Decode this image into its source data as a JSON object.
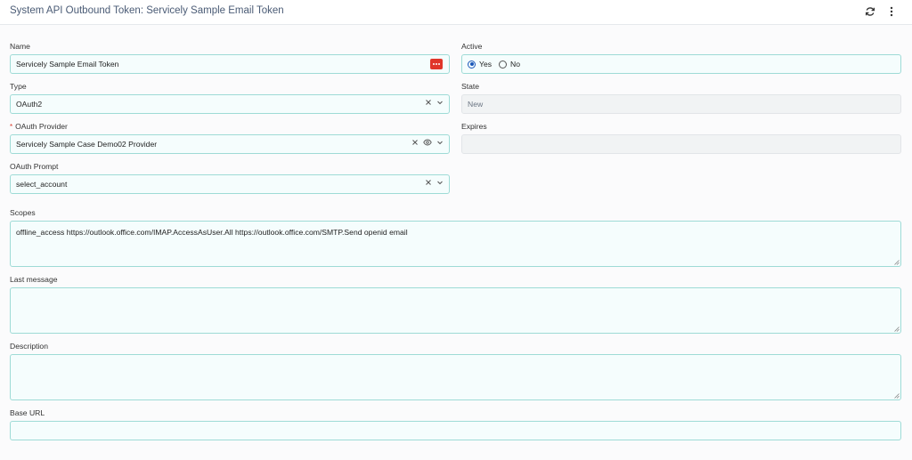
{
  "header": {
    "title": "System API Outbound Token: Servicely Sample Email Token",
    "refresh_icon": "refresh-icon",
    "menu_icon": "more-vertical-icon"
  },
  "form": {
    "name": {
      "label": "Name",
      "value": "Servicely Sample Email Token",
      "icon": "password-dots-icon"
    },
    "active": {
      "label": "Active",
      "options": [
        "Yes",
        "No"
      ],
      "selected": "Yes"
    },
    "type": {
      "label": "Type",
      "value": "OAuth2"
    },
    "state": {
      "label": "State",
      "value": "New"
    },
    "oauth_provider": {
      "label": "OAuth Provider",
      "required_marker": "*",
      "value": "Servicely Sample Case Demo02 Provider"
    },
    "expires": {
      "label": "Expires",
      "value": ""
    },
    "oauth_prompt": {
      "label": "OAuth Prompt",
      "value": "select_account"
    },
    "scopes": {
      "label": "Scopes",
      "value": "offline_access https://outlook.office.com/IMAP.AccessAsUser.All https://outlook.office.com/SMTP.Send openid email"
    },
    "last_message": {
      "label": "Last message",
      "value": ""
    },
    "description": {
      "label": "Description",
      "value": ""
    },
    "base_url": {
      "label": "Base URL",
      "value": ""
    }
  },
  "colors": {
    "field_border": "#9edbd6",
    "field_bg": "#f5fdfd",
    "title_color": "#4a5b75",
    "required": "#d83a2a",
    "password_icon_bg": "#e0362a"
  }
}
